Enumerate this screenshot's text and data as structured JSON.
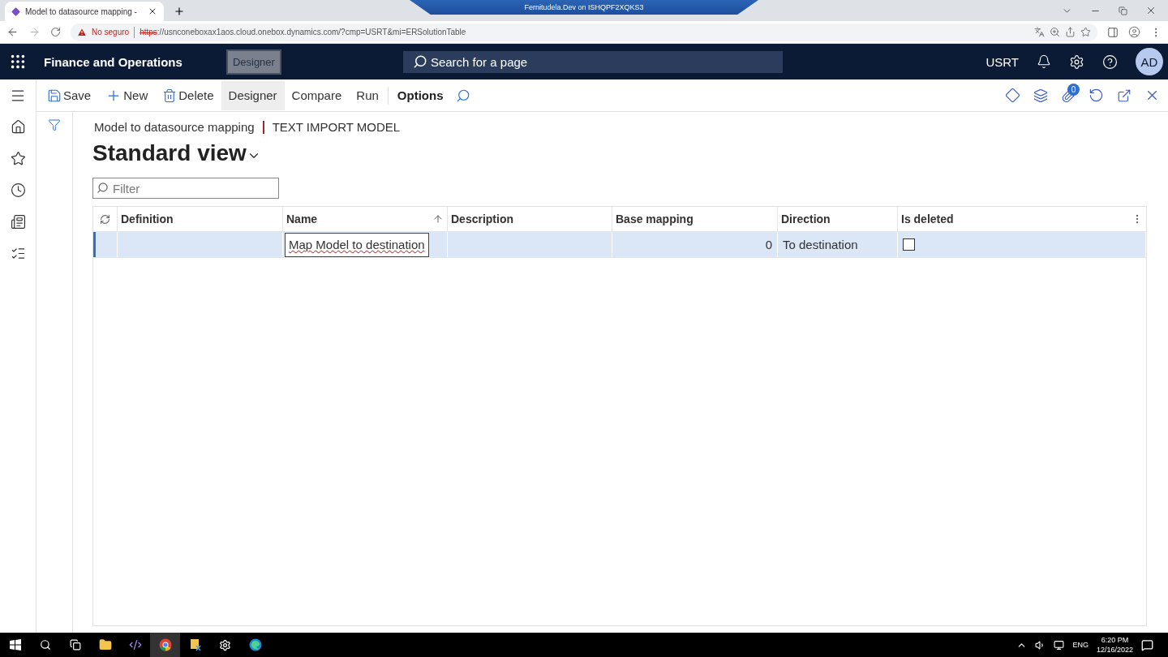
{
  "browser": {
    "tab_title": "Model to datasource mapping -",
    "remote_title": "Fernitudela.Dev on ISHQPF2XQKS3",
    "security": "No seguro",
    "url_scheme": "https",
    "url_rest": "://usnconeboxax1aos.cloud.onebox.dynamics.com/?cmp=USRT&mi=ERSolutionTable"
  },
  "app": {
    "title": "Finance and Operations",
    "mode_badge": "Designer",
    "search_placeholder": "Search for a page",
    "company": "USRT",
    "avatar": "AD"
  },
  "toolbar": {
    "items": [
      {
        "kind": "save",
        "label": "Save",
        "selected": false
      },
      {
        "kind": "new",
        "label": "New",
        "selected": false
      },
      {
        "kind": "delete",
        "label": "Delete",
        "selected": false
      },
      {
        "kind": "plain",
        "label": "Designer",
        "selected": true
      },
      {
        "kind": "plain",
        "label": "Compare",
        "selected": false
      },
      {
        "kind": "plain",
        "label": "Run",
        "selected": false
      }
    ],
    "options": "Options",
    "attachments_count": "0"
  },
  "breadcrumb": [
    "Model to datasource mapping",
    "TEXT IMPORT MODEL"
  ],
  "view_title": "Standard view",
  "filter": {
    "placeholder": "Filter"
  },
  "grid": {
    "columns": [
      {
        "label": "Definition",
        "sorted": false
      },
      {
        "label": "Name",
        "sorted": true
      },
      {
        "label": "Description",
        "sorted": false
      },
      {
        "label": "Base mapping",
        "sorted": false
      },
      {
        "label": "Direction",
        "sorted": false
      },
      {
        "label": "Is deleted",
        "sorted": false
      }
    ],
    "rows": [
      {
        "selected": true,
        "name": "Map Model to destination",
        "editing": true,
        "base_mapping": "0",
        "direction": "To destination",
        "is_deleted": false
      }
    ]
  },
  "taskbar": {
    "language": "ENG",
    "time": "6:20 PM",
    "date": "12/16/2022"
  }
}
